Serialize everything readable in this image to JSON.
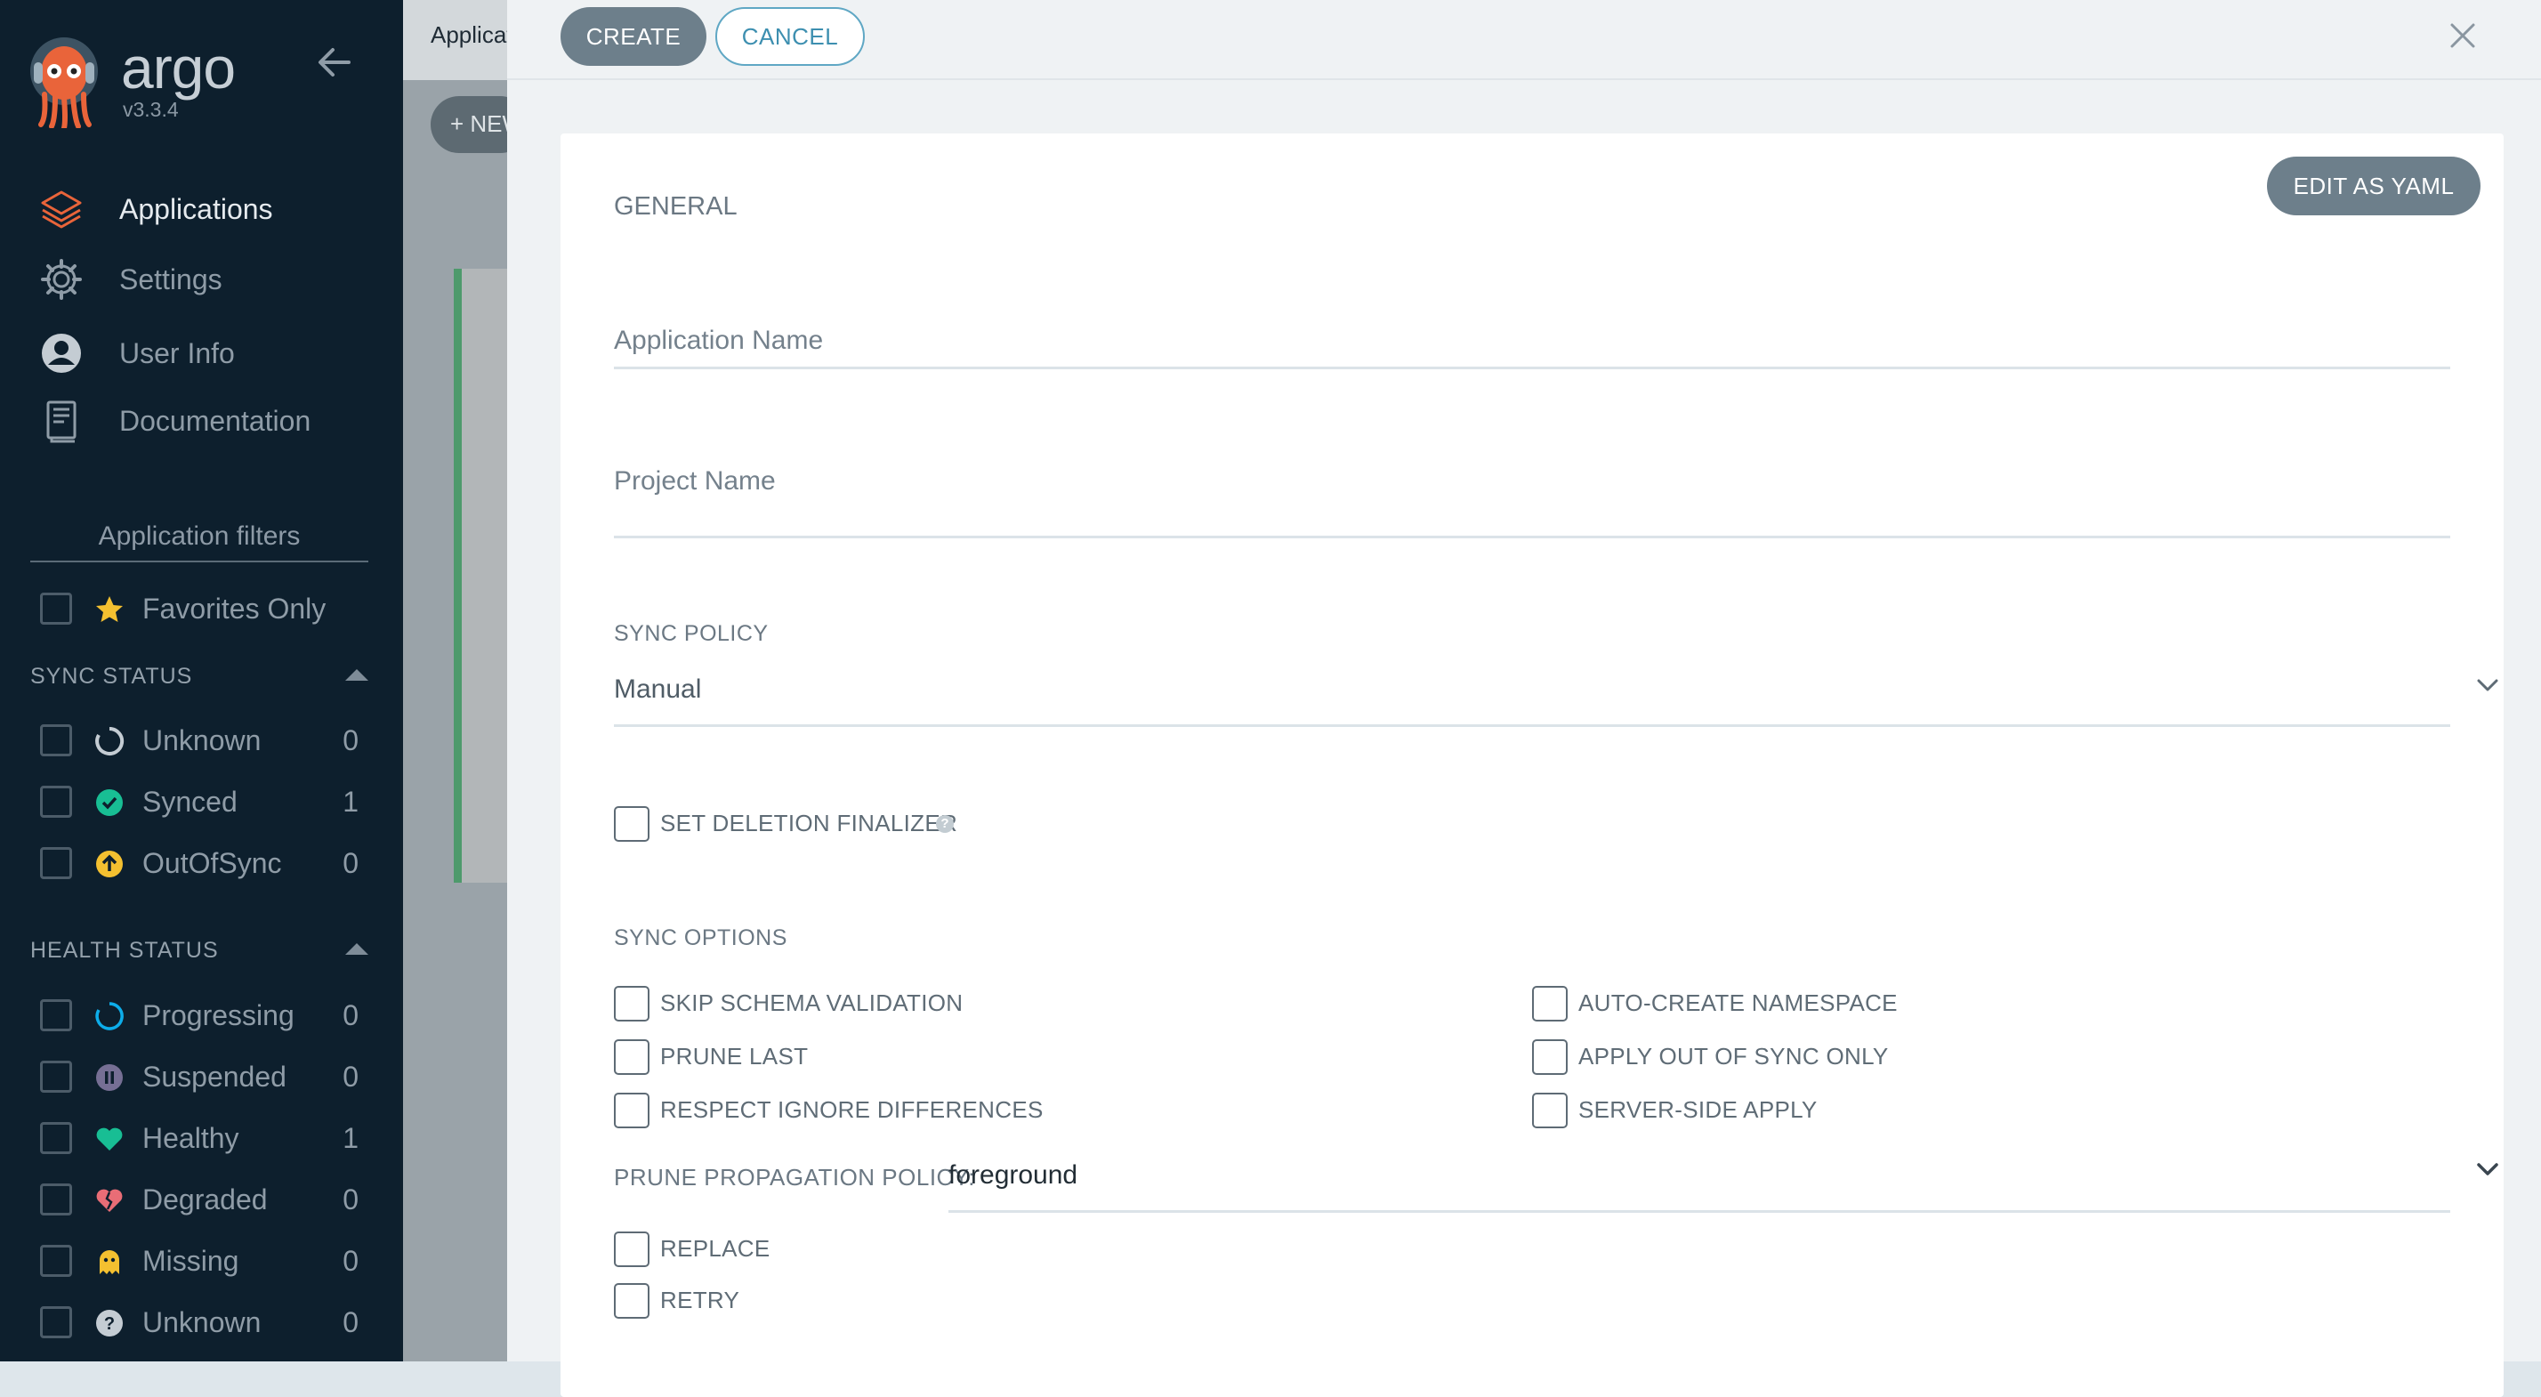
{
  "sidebar": {
    "brand": "argo",
    "version": "v3.3.4",
    "nav": [
      {
        "label": "Applications",
        "icon": "layers-icon",
        "active": true
      },
      {
        "label": "Settings",
        "icon": "gear-icon"
      },
      {
        "label": "User Info",
        "icon": "user-icon"
      },
      {
        "label": "Documentation",
        "icon": "book-icon"
      }
    ],
    "filters_title": "Application filters",
    "favorites_label": "Favorites Only",
    "sync_status": {
      "title": "SYNC STATUS",
      "items": [
        {
          "label": "Unknown",
          "count": "0",
          "icon": "circle-notch-icon"
        },
        {
          "label": "Synced",
          "count": "1",
          "icon": "check-circle-icon"
        },
        {
          "label": "OutOfSync",
          "count": "0",
          "icon": "arrow-up-circle-icon"
        }
      ]
    },
    "health_status": {
      "title": "HEALTH STATUS",
      "items": [
        {
          "label": "Progressing",
          "count": "0",
          "icon": "spinner-icon"
        },
        {
          "label": "Suspended",
          "count": "0",
          "icon": "pause-circle-icon"
        },
        {
          "label": "Healthy",
          "count": "1",
          "icon": "heart-icon"
        },
        {
          "label": "Degraded",
          "count": "0",
          "icon": "broken-heart-icon"
        },
        {
          "label": "Missing",
          "count": "0",
          "icon": "ghost-icon"
        },
        {
          "label": "Unknown",
          "count": "0",
          "icon": "question-circle-icon"
        }
      ]
    }
  },
  "background": {
    "title": "Applications",
    "new_app_label": "+ NEW APP"
  },
  "panel": {
    "create_label": "CREATE",
    "cancel_label": "CANCEL",
    "edit_yaml_label": "EDIT AS YAML",
    "general_title": "GENERAL",
    "app_name_label": "Application Name",
    "project_name_label": "Project Name",
    "sync_policy_label": "SYNC POLICY",
    "sync_policy_value": "Manual",
    "deletion_finalizer_label": "SET DELETION FINALIZER",
    "sync_options_title": "SYNC OPTIONS",
    "options_left": [
      "SKIP SCHEMA VALIDATION",
      "PRUNE LAST",
      "RESPECT IGNORE DIFFERENCES"
    ],
    "options_right": [
      "AUTO-CREATE NAMESPACE",
      "APPLY OUT OF SYNC ONLY",
      "SERVER-SIDE APPLY"
    ],
    "prune_policy_label": "PRUNE PROPAGATION POLICY:",
    "prune_policy_value": "foreground",
    "options_bottom": [
      "REPLACE",
      "RETRY"
    ]
  },
  "colors": {
    "sidebar_bg": "#0d1f2d",
    "synced": "#18be94",
    "out_of_sync": "#f4c030",
    "healthy": "#18be94",
    "degraded": "#e96d76",
    "progressing": "#0dadea",
    "suspended": "#766f94"
  }
}
